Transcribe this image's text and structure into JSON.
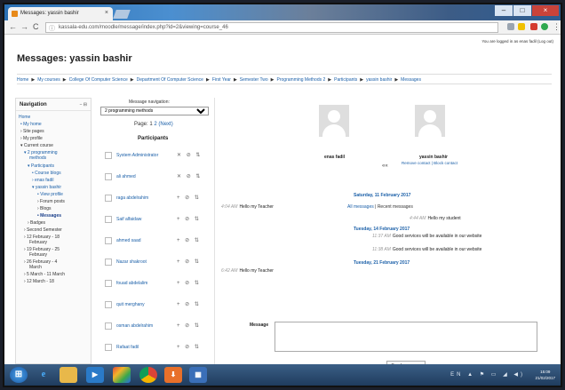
{
  "browser": {
    "tab_title": "Messages: yassin bashir",
    "tab_close": "×",
    "url": "kassala-edu.com/moodle/message/index.php?id=2&viewing=course_46",
    "back": "←",
    "forward": "→",
    "reload": "C",
    "lock": "ⓘ",
    "win_min": "–",
    "win_max": "□",
    "win_close": "×"
  },
  "page": {
    "logged_in": "You are logged in as enas fadil (Log out)",
    "heading": "Messages: yassin bashir",
    "breadcrumb": [
      "Home",
      "My courses",
      "College Of Computer Science",
      "Department Of Computer Science",
      "First Year",
      "Semester Two",
      "Programming Methods 2",
      "Participants",
      "yassin bashir",
      "Messages"
    ],
    "breadcrumb_sep": "▶"
  },
  "navigation": {
    "title": "Navigation",
    "controls": "– ⊟",
    "items": [
      {
        "label": "Home"
      },
      {
        "label": "• My home"
      },
      {
        "label": "› Site pages"
      },
      {
        "label": "› My profile"
      },
      {
        "label": "▾ Current course"
      },
      {
        "label": "▾ 2 programming"
      },
      {
        "label": "methods"
      },
      {
        "label": "▾ Participants"
      },
      {
        "label": "• Course blogs"
      },
      {
        "label": "› enas fadil"
      },
      {
        "label": "▾ yassin bashir"
      },
      {
        "label": "• View profile"
      },
      {
        "label": "› Forum posts"
      },
      {
        "label": "› Blogs"
      },
      {
        "label": "• Messages"
      },
      {
        "label": "› Badges"
      },
      {
        "label": "› Second Semester"
      },
      {
        "label": "› 12 February - 18"
      },
      {
        "label": "February"
      },
      {
        "label": "› 19 February - 25"
      },
      {
        "label": "February"
      },
      {
        "label": "› 26 February - 4"
      },
      {
        "label": "March"
      },
      {
        "label": "› 5 March - 11 March"
      },
      {
        "label": "› 12 March - 18"
      }
    ]
  },
  "message_nav": {
    "label": "Message navigation:",
    "selected": "2 programming methods",
    "page_label": "Page:",
    "page_1": "1",
    "page_2": "2",
    "page_next": "(Next)",
    "participants_heading": "Participants",
    "participants": [
      {
        "name": "System Administrator",
        "actions": "✕ ⊘ ⇅"
      },
      {
        "name": "ali ahmed",
        "actions": "✕ ⊘ ⇅"
      },
      {
        "name": "raga abdelrahim",
        "actions": "+ ⊘ ⇅"
      },
      {
        "name": "Saif alfaidaw",
        "actions": "+ ⊘ ⇅"
      },
      {
        "name": "ahmed saad",
        "actions": "+ ⊘ ⇅"
      },
      {
        "name": "Nazar shakroot",
        "actions": "+ ⊘ ⇅"
      },
      {
        "name": "fouad abdelalim",
        "actions": "+ ⊘ ⇅"
      },
      {
        "name": "quit merghany",
        "actions": "+ ⊘ ⇅"
      },
      {
        "name": "osman abdelrahim",
        "actions": "+ ⊘ ⇅"
      },
      {
        "name": "Rafaat fadil",
        "actions": "+ ⊘ ⇅"
      }
    ]
  },
  "conversation": {
    "user1_name": "enas fadil",
    "separator": "««",
    "user2_name": "yassin bashir",
    "user2_links": "Remove contact | Block contact",
    "tab_all": "All messages",
    "tab_sep": " | ",
    "tab_recent": "Recent messages",
    "date1": "Saturday, 11 February 2017",
    "m1_time": "4:04 AM",
    "m1_text": "Hello my Teacher",
    "m2_time": "4:44 AM",
    "m2_text": "Hello my student",
    "date2": "Tuesday, 14 February 2017",
    "m3_time": "11:37 AM",
    "m3_text": "Good services will be available in our website",
    "m4_time": "11:38 AM",
    "m4_text": "Good services will be available in our website",
    "date3": "Tuesday, 21 February 2017",
    "m5_time": "6:42 AM",
    "m5_text": "Hello my Teacher",
    "message_label": "Message",
    "send_label": "Send message"
  },
  "taskbar": {
    "tray": "EN ▲ ⚑ ▭ ◢ ◀)",
    "time": "15:09",
    "date": "21/02/2017"
  }
}
